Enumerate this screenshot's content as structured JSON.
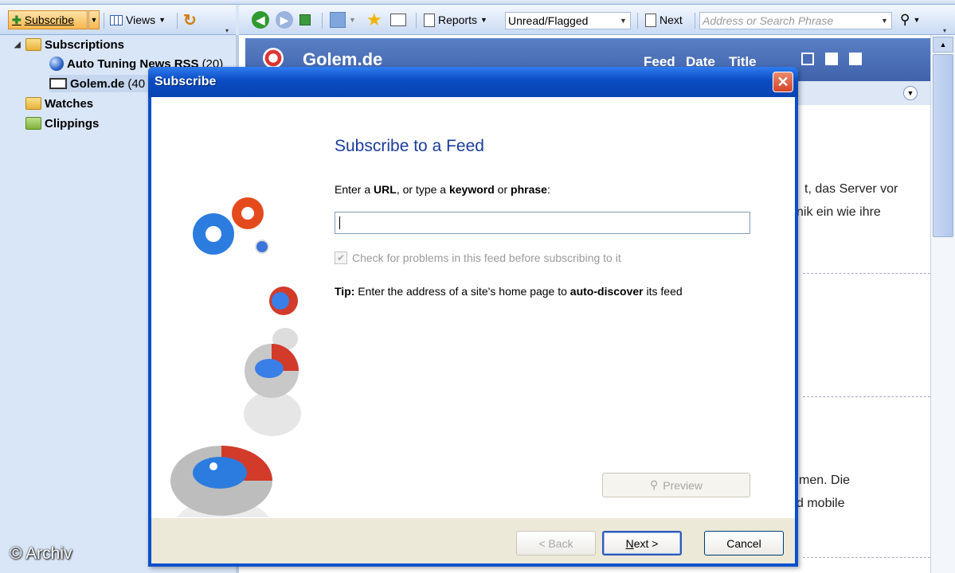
{
  "toolbar": {
    "subscribe_label": "Subscribe",
    "views_label": "Views",
    "reports_label": "Reports",
    "filter_value": "Unread/Flagged",
    "next_label": "Next",
    "search_placeholder": "Address or Search Phrase"
  },
  "tree": {
    "subscriptions_label": "Subscriptions",
    "feeds": [
      {
        "label": "Auto Tuning News RSS",
        "count": "(20)"
      },
      {
        "label": "Golem.de",
        "count": "(40"
      }
    ],
    "watches_label": "Watches",
    "clippings_label": "Clippings"
  },
  "feed": {
    "title": "Golem.de",
    "sort_feed": "Feed",
    "sort_date": "Date",
    "sort_title": "Title",
    "text_lines": [
      "t, das Server vor",
      "nik ein wie ihre",
      "men. Die",
      "d mobile"
    ]
  },
  "dialog": {
    "title": "Subscribe",
    "heading": "Subscribe to a Feed",
    "prompt_pre": "Enter a ",
    "prompt_url": "URL",
    "prompt_mid": ", or type a ",
    "prompt_keyword": "keyword",
    "prompt_or": " or ",
    "prompt_phrase": "phrase",
    "prompt_end": ":",
    "url_value": "",
    "check_label": "Check for problems in this feed before subscribing to it",
    "check_checked": true,
    "tip_label": "Tip:",
    "tip_pre": " Enter the address of a site's home page to ",
    "tip_bold": "auto-discover",
    "tip_post": " its feed",
    "preview_label": "Preview",
    "back_label": "< Back",
    "next_label": "Next >",
    "cancel_label": "Cancel"
  },
  "watermark": "© Archiv",
  "colors": {
    "titlebar": "#0a4cc2",
    "heading": "#1a3d9c",
    "feed_header": "#4a6db5",
    "subscribe_button": "#f6b84e"
  }
}
